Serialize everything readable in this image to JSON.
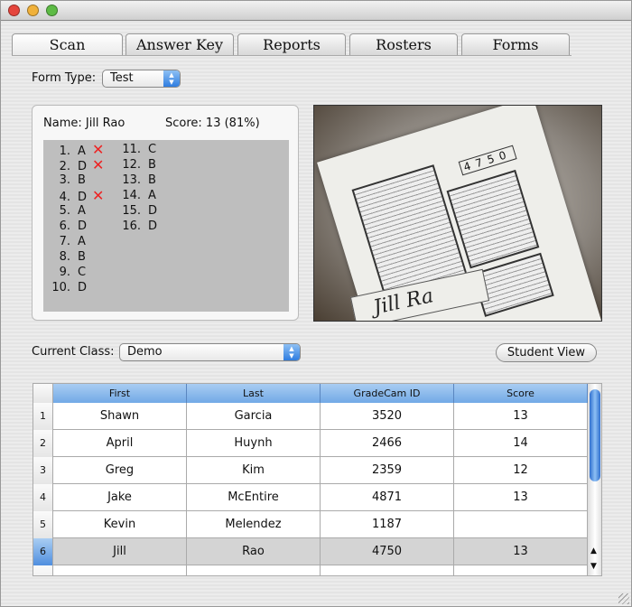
{
  "tabs": [
    {
      "label": "Scan",
      "active": true
    },
    {
      "label": "Answer Key"
    },
    {
      "label": "Reports"
    },
    {
      "label": "Rosters"
    },
    {
      "label": "Forms"
    }
  ],
  "form_type": {
    "label": "Form Type:",
    "value": "Test"
  },
  "result": {
    "name": "Name: Jill Rao",
    "score": "Score: 13 (81%)",
    "answers": [
      {
        "n": "1.",
        "a": "A",
        "wrong": true
      },
      {
        "n": "2.",
        "a": "D",
        "wrong": true
      },
      {
        "n": "3.",
        "a": "B"
      },
      {
        "n": "4.",
        "a": "D",
        "wrong": true
      },
      {
        "n": "5.",
        "a": "A"
      },
      {
        "n": "6.",
        "a": "D"
      },
      {
        "n": "7.",
        "a": "A"
      },
      {
        "n": "8.",
        "a": "B"
      },
      {
        "n": "9.",
        "a": "C"
      },
      {
        "n": "10.",
        "a": "D"
      },
      {
        "n": "11.",
        "a": "C"
      },
      {
        "n": "12.",
        "a": "B"
      },
      {
        "n": "13.",
        "a": "B"
      },
      {
        "n": "14.",
        "a": "A"
      },
      {
        "n": "15.",
        "a": "D"
      },
      {
        "n": "16.",
        "a": "D"
      }
    ]
  },
  "current_class": {
    "label": "Current Class:",
    "value": "Demo"
  },
  "student_view_label": "Student View",
  "table": {
    "columns": [
      "First",
      "Last",
      "GradeCam ID",
      "Score"
    ],
    "rows": [
      {
        "idx": "1",
        "first": "Shawn",
        "last": "Garcia",
        "id": "3520",
        "score": "13"
      },
      {
        "idx": "2",
        "first": "April",
        "last": "Huynh",
        "id": "2466",
        "score": "14"
      },
      {
        "idx": "3",
        "first": "Greg",
        "last": "Kim",
        "id": "2359",
        "score": "12"
      },
      {
        "idx": "4",
        "first": "Jake",
        "last": "McEntire",
        "id": "4871",
        "score": "13"
      },
      {
        "idx": "5",
        "first": "Kevin",
        "last": "Melendez",
        "id": "1187",
        "score": ""
      },
      {
        "idx": "6",
        "first": "Jill",
        "last": "Rao",
        "id": "4750",
        "score": "13",
        "selected": true
      }
    ]
  },
  "photo": {
    "id_digits": "4750",
    "name": "Jill Ra"
  }
}
